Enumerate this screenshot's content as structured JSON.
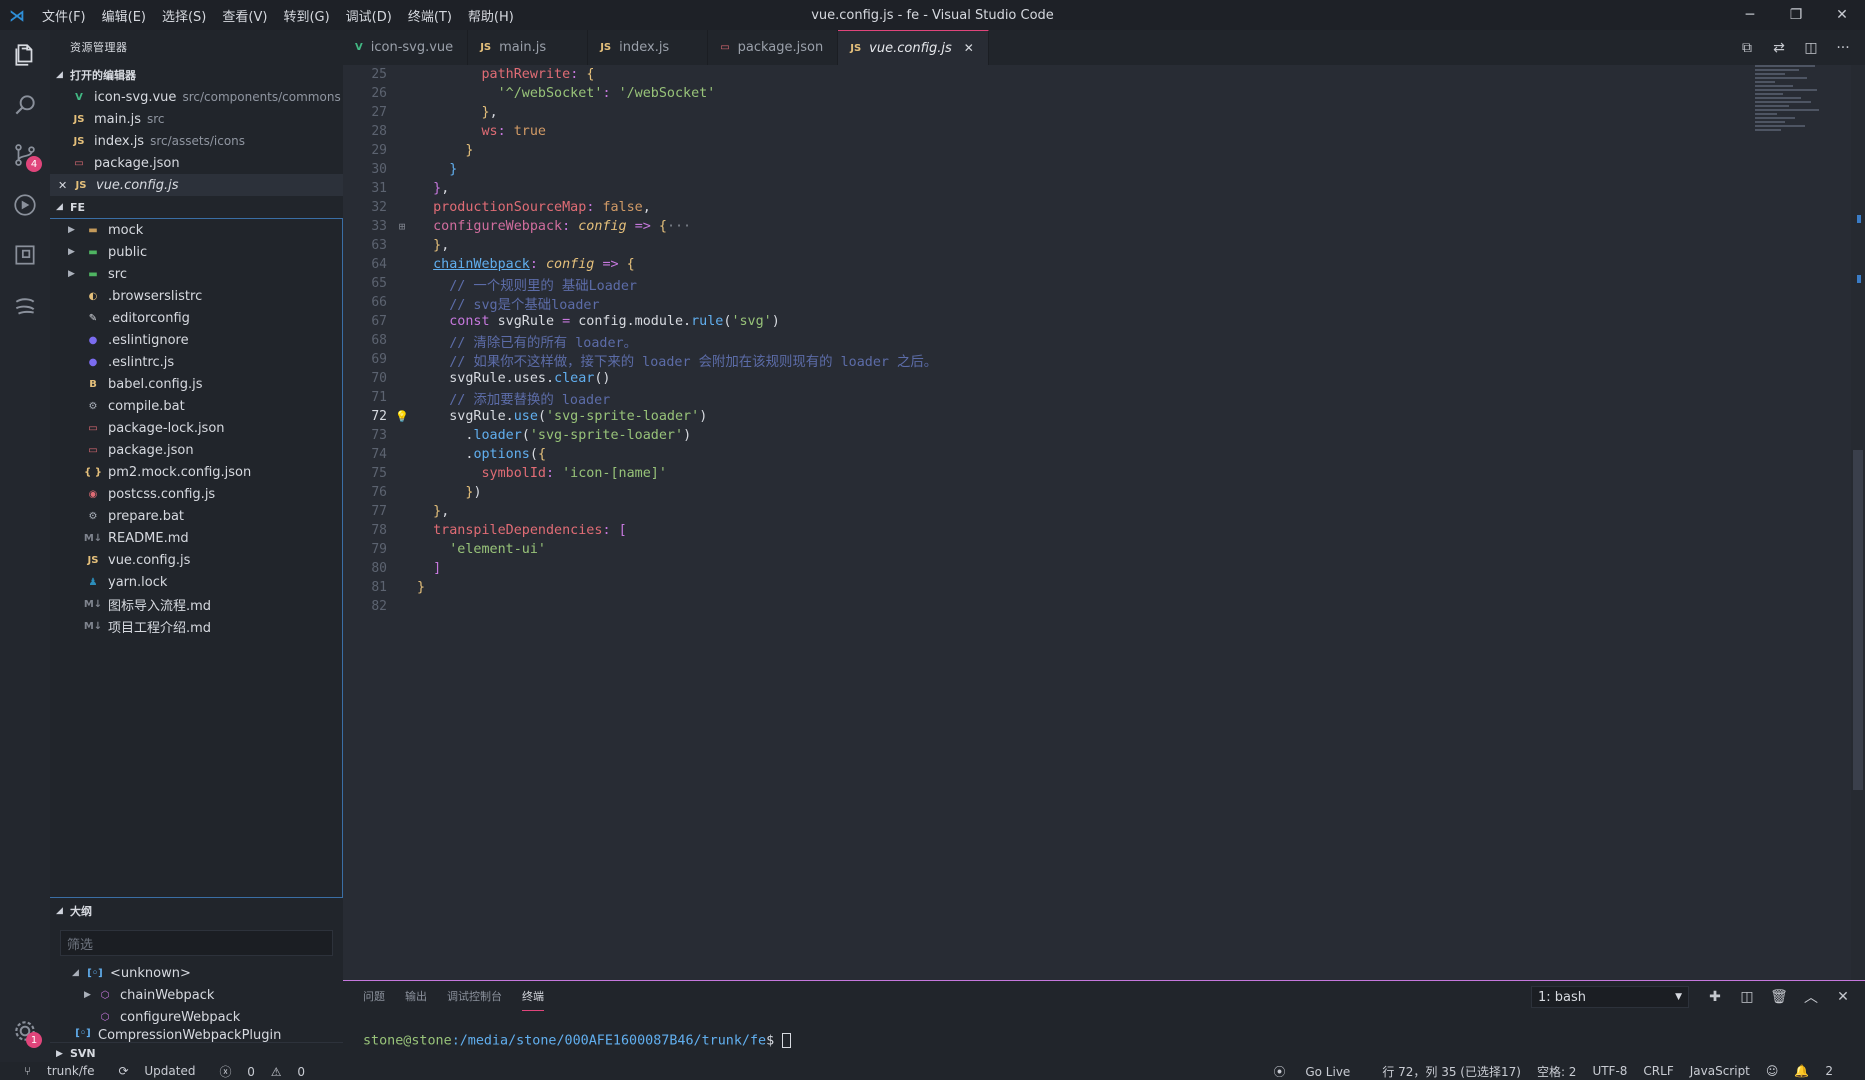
{
  "titlebar": {
    "menu": [
      "文件(F)",
      "编辑(E)",
      "选择(S)",
      "查看(V)",
      "转到(G)",
      "调试(D)",
      "终端(T)",
      "帮助(H)"
    ],
    "title": "vue.config.js - fe - Visual Studio Code"
  },
  "activity": {
    "scm_badge": "4",
    "settings_badge": "1"
  },
  "sidebar": {
    "title": "资源管理器",
    "open_editors": {
      "label": "打开的编辑器",
      "items": [
        {
          "name": "icon-svg.vue",
          "desc": "src/components/commons",
          "icon": "V",
          "color": "#42b883"
        },
        {
          "name": "main.js",
          "desc": "src",
          "icon": "JS",
          "color": "#e5c07b"
        },
        {
          "name": "index.js",
          "desc": "src/assets/icons",
          "icon": "JS",
          "color": "#e5c07b"
        },
        {
          "name": "package.json",
          "desc": "",
          "icon": "▭",
          "color": "#e06c75"
        },
        {
          "name": "vue.config.js",
          "desc": "",
          "icon": "JS",
          "color": "#e5c07b"
        }
      ]
    },
    "project": {
      "label": "FE",
      "folders": [
        {
          "name": "mock",
          "icon": "▬",
          "color": "#c49a5a"
        },
        {
          "name": "public",
          "icon": "▬",
          "color": "#4fb562"
        },
        {
          "name": "src",
          "icon": "▬",
          "color": "#4fb562"
        }
      ],
      "files": [
        {
          "name": ".browserslistrc",
          "icon": "◐",
          "color": "#e5c07b"
        },
        {
          "name": ".editorconfig",
          "icon": "✎",
          "color": "#d7dae0"
        },
        {
          "name": ".eslintignore",
          "icon": "●",
          "color": "#7b6cf0"
        },
        {
          "name": ".eslintrc.js",
          "icon": "●",
          "color": "#7b6cf0"
        },
        {
          "name": "babel.config.js",
          "icon": "B",
          "color": "#e5c07b"
        },
        {
          "name": "compile.bat",
          "icon": "⚙",
          "color": "#aab0ba"
        },
        {
          "name": "package-lock.json",
          "icon": "▭",
          "color": "#e06c75"
        },
        {
          "name": "package.json",
          "icon": "▭",
          "color": "#e06c75"
        },
        {
          "name": "pm2.mock.config.json",
          "icon": "{ }",
          "color": "#e5c07b"
        },
        {
          "name": "postcss.config.js",
          "icon": "◉",
          "color": "#e06c75"
        },
        {
          "name": "prepare.bat",
          "icon": "⚙",
          "color": "#aab0ba"
        },
        {
          "name": "README.md",
          "icon": "M↓",
          "color": "#7f848e"
        },
        {
          "name": "vue.config.js",
          "icon": "JS",
          "color": "#e5c07b"
        },
        {
          "name": "yarn.lock",
          "icon": "♟",
          "color": "#2c8ebb"
        },
        {
          "name": "图标导入流程.md",
          "icon": "M↓",
          "color": "#7f848e"
        },
        {
          "name": "项目工程介绍.md",
          "icon": "M↓",
          "color": "#7f848e"
        }
      ]
    },
    "outline": {
      "label": "大纲",
      "filter_placeholder": "筛选",
      "items": [
        "<unknown>",
        "chainWebpack",
        "configureWebpack",
        "CompressionWebpackPlugin"
      ]
    },
    "svn_label": "SVN"
  },
  "tabs": [
    {
      "label": "icon-svg.vue",
      "icon": "V",
      "color": "#42b883"
    },
    {
      "label": "main.js",
      "icon": "JS",
      "color": "#e5c07b"
    },
    {
      "label": "index.js",
      "icon": "JS",
      "color": "#e5c07b"
    },
    {
      "label": "package.json",
      "icon": "▭",
      "color": "#e06c75"
    },
    {
      "label": "vue.config.js",
      "icon": "JS",
      "color": "#e5c07b",
      "active": true
    }
  ],
  "editor": {
    "current_line": 72,
    "lines": [
      {
        "n": 25,
        "html": "        <span class='p'>pathRewrite</span><span class='k'>:</span> <span class='y'>{</span>"
      },
      {
        "n": 26,
        "html": "          <span class='s'>'^/webSocket'</span><span class='k'>:</span> <span class='s'>'/webSocket'</span>"
      },
      {
        "n": 27,
        "html": "        <span class='y'>}</span>,"
      },
      {
        "n": 28,
        "html": "        <span class='p'>ws</span><span class='k'>:</span> <span class='b'>true</span>"
      },
      {
        "n": 29,
        "html": "      <span class='y'>}</span>"
      },
      {
        "n": 30,
        "html": "    <span class='f'>}</span>"
      },
      {
        "n": 31,
        "html": "  <span class='k'>}</span>,"
      },
      {
        "n": 32,
        "html": "  <span class='p'>productionSourceMap</span><span class='k'>:</span> <span class='b'>false</span>,"
      },
      {
        "n": 33,
        "html": "  <span class='pink'>configureWebpack</span><span class='k'>:</span> <span class='y it'>config</span> <span class='k'>=&gt;</span> <span class='y'>{</span><span class='fold'>···</span>",
        "fold": true
      },
      {
        "n": 63,
        "html": "  <span class='y'>}</span>,"
      },
      {
        "n": 64,
        "html": "  <span class='f ul'>chainWebpack</span><span class='k'>:</span> <span class='y it'>config</span> <span class='k'>=&gt;</span> <span class='y'>{</span>"
      },
      {
        "n": 65,
        "html": "    <span class='c'>// 一个规则里的 基础Loader</span>"
      },
      {
        "n": 66,
        "html": "    <span class='c'>// svg是个基础loader</span>"
      },
      {
        "n": 67,
        "html": "    <span class='k'>const</span> svgRule <span class='k'>=</span> config.module.<span class='f'>rule</span>(<span class='s'>'svg'</span>)"
      },
      {
        "n": 68,
        "html": "    <span class='c'>// 清除已有的所有 loader。</span>"
      },
      {
        "n": 69,
        "html": "    <span class='c'>// 如果你不这样做，接下来的 loader 会附加在该规则现有的 loader 之后。</span>"
      },
      {
        "n": 70,
        "html": "    svgRule.uses.<span class='f'>clear</span>()"
      },
      {
        "n": 71,
        "html": "    <span class='c'>// 添加要替换的 loader</span>"
      },
      {
        "n": 72,
        "html": "    svgRule.<span class='f'>use</span>(<span class='s'>'svg-sprite-loader'</span>)",
        "bulb": true
      },
      {
        "n": 73,
        "html": "      .<span class='f'>loader</span>(<span class='s'>'svg-sprite-loader'</span>)"
      },
      {
        "n": 74,
        "html": "      .<span class='f'>options</span>(<span class='y'>{</span>"
      },
      {
        "n": 75,
        "html": "        <span class='p'>symbolId</span><span class='k'>:</span> <span class='s'>'icon-[name]'</span>"
      },
      {
        "n": 76,
        "html": "      <span class='y'>}</span>)"
      },
      {
        "n": 77,
        "html": "  <span class='y'>}</span>,"
      },
      {
        "n": 78,
        "html": "  <span class='p'>transpileDependencies</span><span class='k'>:</span> <span class='k'>[</span>"
      },
      {
        "n": 79,
        "html": "    <span class='s'>'element-ui'</span>"
      },
      {
        "n": 80,
        "html": "  <span class='k'>]</span>"
      },
      {
        "n": 81,
        "html": "<span class='y'>}</span>"
      },
      {
        "n": 82,
        "html": ""
      }
    ]
  },
  "panel": {
    "tabs": [
      "问题",
      "输出",
      "调试控制台",
      "终端"
    ],
    "active_tab": "终端",
    "terminal_select": "1: bash",
    "prompt_user": "stone@stone",
    "prompt_path": ":/media/stone/000AFE1600087B46/trunk/fe",
    "prompt_suffix": "$ "
  },
  "statusbar": {
    "branch": "trunk/fe",
    "sync": "Updated",
    "errors": "0",
    "warnings": "0",
    "golive": "Go Live",
    "position": "行 72，列 35 (已选择17)",
    "spaces": "空格: 2",
    "encoding": "UTF-8",
    "eol": "CRLF",
    "language": "JavaScript",
    "notifications": "2"
  }
}
